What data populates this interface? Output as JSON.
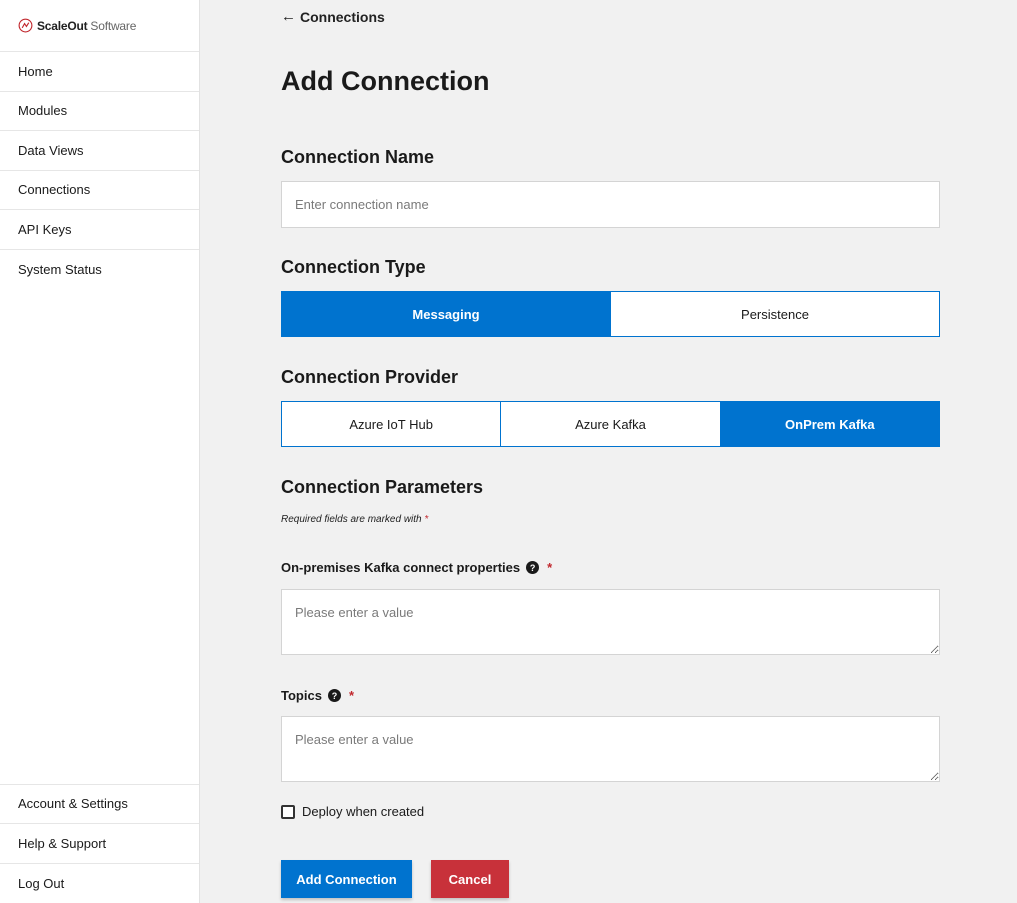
{
  "brand": {
    "name_bold": "ScaleOut",
    "name_light": "Software"
  },
  "sidebar": {
    "items": [
      {
        "label": "Home"
      },
      {
        "label": "Modules"
      },
      {
        "label": "Data Views"
      },
      {
        "label": "Connections"
      },
      {
        "label": "API Keys"
      },
      {
        "label": "System Status"
      }
    ],
    "bottom_items": [
      {
        "label": "Account & Settings"
      },
      {
        "label": "Help & Support"
      },
      {
        "label": "Log Out"
      }
    ]
  },
  "header": {
    "back_label": "Connections",
    "title": "Add Connection"
  },
  "connection_name": {
    "heading": "Connection Name",
    "placeholder": "Enter connection name",
    "value": ""
  },
  "connection_type": {
    "heading": "Connection Type",
    "options": [
      {
        "label": "Messaging",
        "selected": true
      },
      {
        "label": "Persistence",
        "selected": false
      }
    ]
  },
  "connection_provider": {
    "heading": "Connection Provider",
    "options": [
      {
        "label": "Azure IoT Hub",
        "selected": false
      },
      {
        "label": "Azure Kafka",
        "selected": false
      },
      {
        "label": "OnPrem Kafka",
        "selected": true
      }
    ]
  },
  "connection_parameters": {
    "heading": "Connection Parameters",
    "required_note": "Required fields are marked with",
    "required_star": "*",
    "fields": [
      {
        "label": "On-premises Kafka connect properties",
        "help": "?",
        "required": "*",
        "placeholder": "Please enter a value",
        "value": ""
      },
      {
        "label": "Topics",
        "help": "?",
        "required": "*",
        "placeholder": "Please enter a value",
        "value": ""
      }
    ]
  },
  "deploy_checkbox": {
    "label": "Deploy when created",
    "checked": false
  },
  "actions": {
    "submit_label": "Add Connection",
    "cancel_label": "Cancel"
  },
  "colors": {
    "primary": "#0073cf",
    "danger": "#c8313a",
    "required": "#c1272d",
    "background": "#f1f1f1"
  },
  "icons": {
    "brand": "scaleout-logo-icon",
    "back": "arrow-left-icon",
    "help": "question-circle-icon"
  }
}
